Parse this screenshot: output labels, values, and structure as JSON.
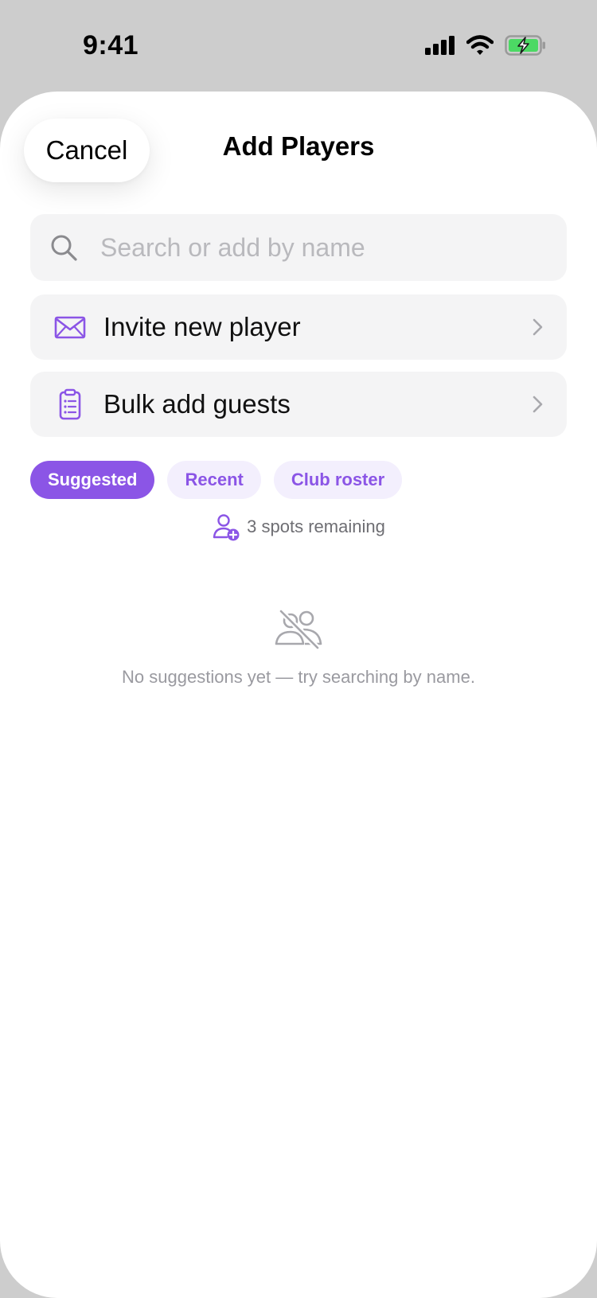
{
  "status_bar": {
    "time": "9:41",
    "icons": [
      "cellular-signal-icon",
      "wifi-icon",
      "battery-charging-icon"
    ],
    "battery_color": "#4cd964"
  },
  "header": {
    "cancel_label": "Cancel",
    "title": "Add Players"
  },
  "search": {
    "placeholder": "Search or add by name",
    "value": "",
    "icon": "search-icon"
  },
  "actions": [
    {
      "label": "Invite new player",
      "icon": "envelope-icon"
    },
    {
      "label": "Bulk add guests",
      "icon": "clipboard-list-icon"
    }
  ],
  "tabs": [
    {
      "label": "Suggested",
      "active": true
    },
    {
      "label": "Recent",
      "active": false
    },
    {
      "label": "Club roster",
      "active": false
    }
  ],
  "spots": {
    "text": "3 spots remaining",
    "icon": "user-add-icon"
  },
  "empty_state": {
    "icon": "users-off-icon",
    "text": "No suggestions yet — try searching by name."
  },
  "colors": {
    "accent": "#8b55e6",
    "accent_soft": "#f3effd",
    "row_background": "#f4f4f5",
    "sheet_background": "#ffffff",
    "backdrop": "#cdcdcd"
  }
}
